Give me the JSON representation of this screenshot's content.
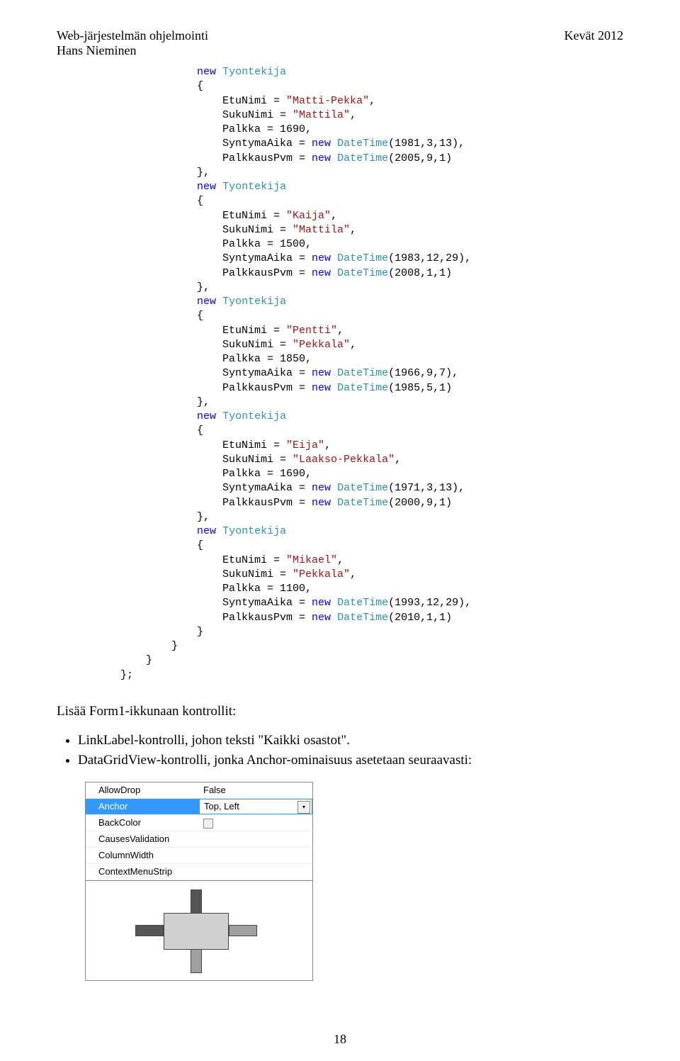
{
  "header": {
    "left_line1": "Web-järjestelmän ohjelmointi",
    "left_line2": "Hans Nieminen",
    "right": "Kevät 2012"
  },
  "code": {
    "indent1": "            ",
    "indent2": "                ",
    "indent3": "                    ",
    "new": "new",
    "tyontekija": "Tyontekija",
    "datetime": "DateTime",
    "obrace": "{",
    "cbrace": "}",
    "cbrace_comma": "},",
    "cbrace_semi": "};",
    "employees": [
      {
        "etu": "\"Matti-Pekka\"",
        "suku": "\"Mattila\"",
        "palkka": "1690",
        "synt": "(1981,3,13)",
        "palkkaus": "(2005,9,1)"
      },
      {
        "etu": "\"Kaija\"",
        "suku": "\"Mattila\"",
        "palkka": "1500",
        "synt": "(1983,12,29)",
        "palkkaus": "(2008,1,1)"
      },
      {
        "etu": "\"Pentti\"",
        "suku": "\"Pekkala\"",
        "palkka": "1850",
        "synt": "(1966,9,7)",
        "palkkaus": "(1985,5,1)"
      },
      {
        "etu": "\"Eija\"",
        "suku": "\"Laakso-Pekkala\"",
        "palkka": "1690",
        "synt": "(1971,3,13)",
        "palkkaus": "(2000,9,1)"
      },
      {
        "etu": "\"Mikael\"",
        "suku": "\"Pekkala\"",
        "palkka": "1100",
        "synt": "(1993,12,29)",
        "palkkaus": "(2010,1,1)"
      }
    ],
    "labels": {
      "etunimi": "EtuNimi = ",
      "sukunimi": "SukuNimi = ",
      "palkka": "Palkka = ",
      "syntyma": "SyntymaAika = ",
      "palkkaus": "PalkkausPvm = "
    },
    "trailing_cbrace_count": 3
  },
  "body": {
    "intro": "Lisää Form1-ikkunaan kontrollit:",
    "bullet1": "LinkLabel-kontrolli, johon teksti \"Kaikki osastot\".",
    "bullet2": "DataGridView-kontrolli, jonka Anchor-ominaisuus asetetaan seuraavasti:"
  },
  "propgrid": {
    "rows": [
      {
        "name": "AllowDrop",
        "value": "False",
        "selected": false,
        "hascolor": false
      },
      {
        "name": "Anchor",
        "value": "Top, Left",
        "selected": true,
        "hascolor": false
      },
      {
        "name": "BackColor",
        "value": "",
        "selected": false,
        "hascolor": true
      },
      {
        "name": "CausesValidation",
        "value": "",
        "selected": false,
        "hascolor": false
      },
      {
        "name": "ColumnWidth",
        "value": "",
        "selected": false,
        "hascolor": false
      },
      {
        "name": "ContextMenuStrip",
        "value": "",
        "selected": false,
        "hascolor": false
      }
    ]
  },
  "page_number": "18",
  "icons": {
    "chevron_down": "▾"
  }
}
